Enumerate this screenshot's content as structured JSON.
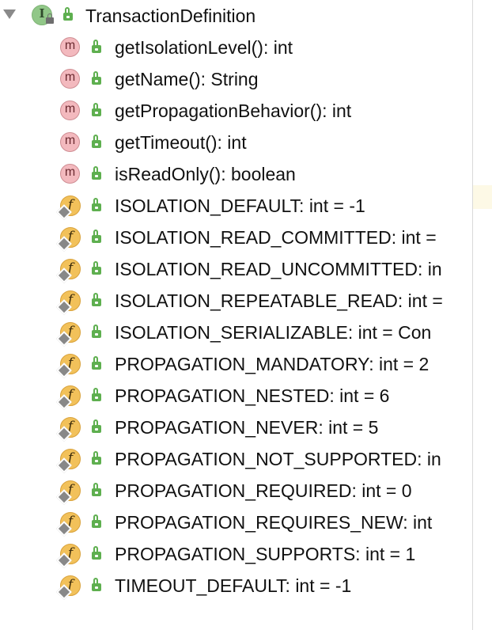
{
  "tree": {
    "root": {
      "label": "TransactionDefinition",
      "icon": "interface-icon",
      "expanded": true
    },
    "members": [
      {
        "kind": "method",
        "label": "getIsolationLevel(): int"
      },
      {
        "kind": "method",
        "label": "getName(): String"
      },
      {
        "kind": "method",
        "label": "getPropagationBehavior(): int"
      },
      {
        "kind": "method",
        "label": "getTimeout(): int"
      },
      {
        "kind": "method",
        "label": "isReadOnly(): boolean"
      },
      {
        "kind": "field",
        "label": "ISOLATION_DEFAULT: int = -1"
      },
      {
        "kind": "field",
        "label": "ISOLATION_READ_COMMITTED: int ="
      },
      {
        "kind": "field",
        "label": "ISOLATION_READ_UNCOMMITTED: in"
      },
      {
        "kind": "field",
        "label": "ISOLATION_REPEATABLE_READ: int ="
      },
      {
        "kind": "field",
        "label": "ISOLATION_SERIALIZABLE: int = Con"
      },
      {
        "kind": "field",
        "label": "PROPAGATION_MANDATORY: int = 2"
      },
      {
        "kind": "field",
        "label": "PROPAGATION_NESTED: int = 6"
      },
      {
        "kind": "field",
        "label": "PROPAGATION_NEVER: int = 5"
      },
      {
        "kind": "field",
        "label": "PROPAGATION_NOT_SUPPORTED: in"
      },
      {
        "kind": "field",
        "label": "PROPAGATION_REQUIRED: int = 0"
      },
      {
        "kind": "field",
        "label": "PROPAGATION_REQUIRES_NEW: int"
      },
      {
        "kind": "field",
        "label": "PROPAGATION_SUPPORTS: int = 1"
      },
      {
        "kind": "field",
        "label": "TIMEOUT_DEFAULT: int = -1"
      }
    ]
  },
  "icons": {
    "interface_letter": "I",
    "method_letter": "m",
    "field_letter": "f"
  },
  "colors": {
    "method_badge": "#f3b9be",
    "field_badge": "#f2c15a",
    "interface_badge": "#91c788",
    "public_lock": "#5eaf4f"
  }
}
